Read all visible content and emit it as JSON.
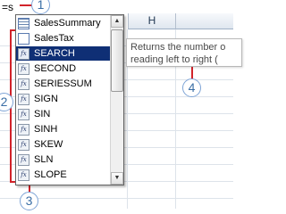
{
  "formula_bar": {
    "cell_text": "=s"
  },
  "column_headers": [
    {
      "label": "H"
    }
  ],
  "function_list": {
    "items": [
      {
        "label": "SalesSummary",
        "icon": "table-icon",
        "selected": false
      },
      {
        "label": "SalesTax",
        "icon": "name-icon",
        "selected": false
      },
      {
        "label": "SEARCH",
        "icon": "fx-icon",
        "selected": true
      },
      {
        "label": "SECOND",
        "icon": "fx-icon",
        "selected": false
      },
      {
        "label": "SERIESSUM",
        "icon": "fx-icon",
        "selected": false
      },
      {
        "label": "SIGN",
        "icon": "fx-icon",
        "selected": false
      },
      {
        "label": "SIN",
        "icon": "fx-icon",
        "selected": false
      },
      {
        "label": "SINH",
        "icon": "fx-icon",
        "selected": false
      },
      {
        "label": "SKEW",
        "icon": "fx-icon",
        "selected": false
      },
      {
        "label": "SLN",
        "icon": "fx-icon",
        "selected": false
      },
      {
        "label": "SLOPE",
        "icon": "fx-icon",
        "selected": false
      }
    ],
    "icon_glyph": "fx"
  },
  "scrollbar": {
    "up_arrow": "▲",
    "down_arrow": "▼"
  },
  "tooltip": {
    "line1": "Returns the number o",
    "line2": "reading left to right ("
  },
  "callouts": [
    {
      "number": "1"
    },
    {
      "number": "2"
    },
    {
      "number": "3"
    },
    {
      "number": "4"
    }
  ],
  "colors": {
    "selection": "#0f2f75",
    "callout_line": "#d2232a",
    "callout_circle_border": "#7ea4d6",
    "callout_text": "#3a6ea5"
  }
}
